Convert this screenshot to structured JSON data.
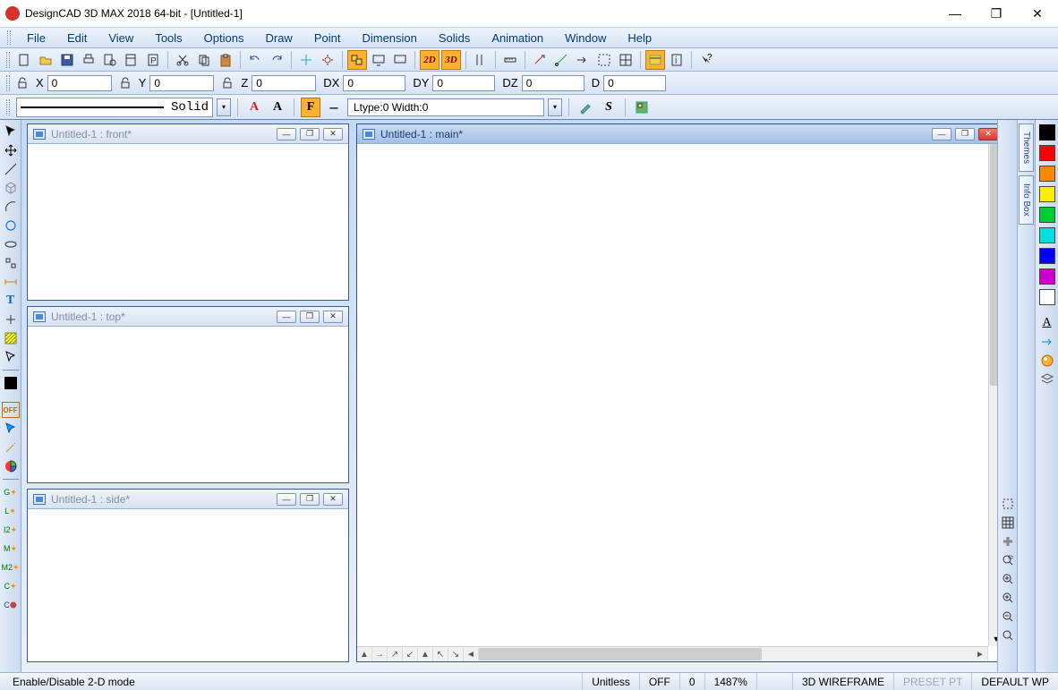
{
  "title": "DesignCAD 3D MAX 2018 64-bit - [Untitled-1]",
  "menus": [
    "File",
    "Edit",
    "View",
    "Tools",
    "Options",
    "Draw",
    "Point",
    "Dimension",
    "Solids",
    "Animation",
    "Window",
    "Help"
  ],
  "coords": {
    "x_label": "X",
    "x": "0",
    "y_label": "Y",
    "y": "0",
    "z_label": "Z",
    "z": "0",
    "dx_label": "DX",
    "dx": "0",
    "dy_label": "DY",
    "dy": "0",
    "dz_label": "DZ",
    "dz": "0",
    "d_label": "D",
    "d": "0"
  },
  "linestyle": {
    "name": "Solid",
    "ltype_width": "Ltype:0  Width:0"
  },
  "mode": {
    "btn2d": "2D",
    "btn3d": "3D"
  },
  "subwindows": {
    "front": "Untitled-1 : front*",
    "top": "Untitled-1 : top*",
    "side": "Untitled-1 : side*",
    "main": "Untitled-1 : main*"
  },
  "tabs": {
    "themes": "Themes",
    "infobox": "Info Box"
  },
  "status": {
    "hint": "Enable/Disable 2-D mode",
    "units": "Unitless",
    "snap": "OFF",
    "n": "0",
    "zoom": "1487%",
    "rendermode": "3D WIREFRAME",
    "preset": "PRESET PT",
    "wp": "DEFAULT WP"
  },
  "palette": [
    "#000000",
    "#ff0000",
    "#ff8800",
    "#ffee00",
    "#00cc33",
    "#00dddd",
    "#0000ff",
    "#cc00cc",
    "#ffffff"
  ],
  "off_label": "OFF",
  "glyphs": {
    "chevdown": "▾",
    "minus": "—",
    "restore": "❐",
    "close": "✕",
    "left": "◄",
    "right": "►",
    "up": "▲",
    "down": "▼",
    "ne": "↗",
    "nw": "↖"
  }
}
